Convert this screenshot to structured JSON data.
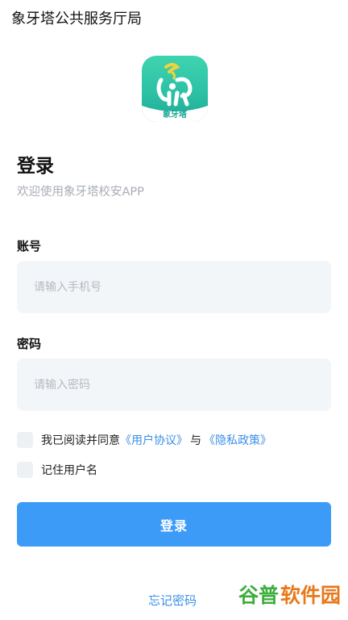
{
  "header": {
    "title": "象牙塔公共服务厅局"
  },
  "logo": {
    "caption": "象牙塔"
  },
  "login": {
    "heading": "登录",
    "subtitle": "欢迎使用象牙塔校安APP"
  },
  "account": {
    "label": "账号",
    "placeholder": "请输入手机号",
    "value": ""
  },
  "password": {
    "label": "密码",
    "placeholder": "请输入密码",
    "value": ""
  },
  "agreement": {
    "prefix": "我已阅读并同意",
    "user_agreement": "《用户协议》",
    "conjunction": "与",
    "privacy_policy": "《隐私政策》"
  },
  "remember": {
    "label": "记住用户名"
  },
  "buttons": {
    "login": "登录",
    "forgot": "忘记密码"
  },
  "watermark": {
    "text": "谷普软件园"
  },
  "colors": {
    "primary": "#3d9bf8",
    "link": "#3a8fe8",
    "logo_teal": "#2bbfa4",
    "input_bg": "#f3f6f9"
  }
}
